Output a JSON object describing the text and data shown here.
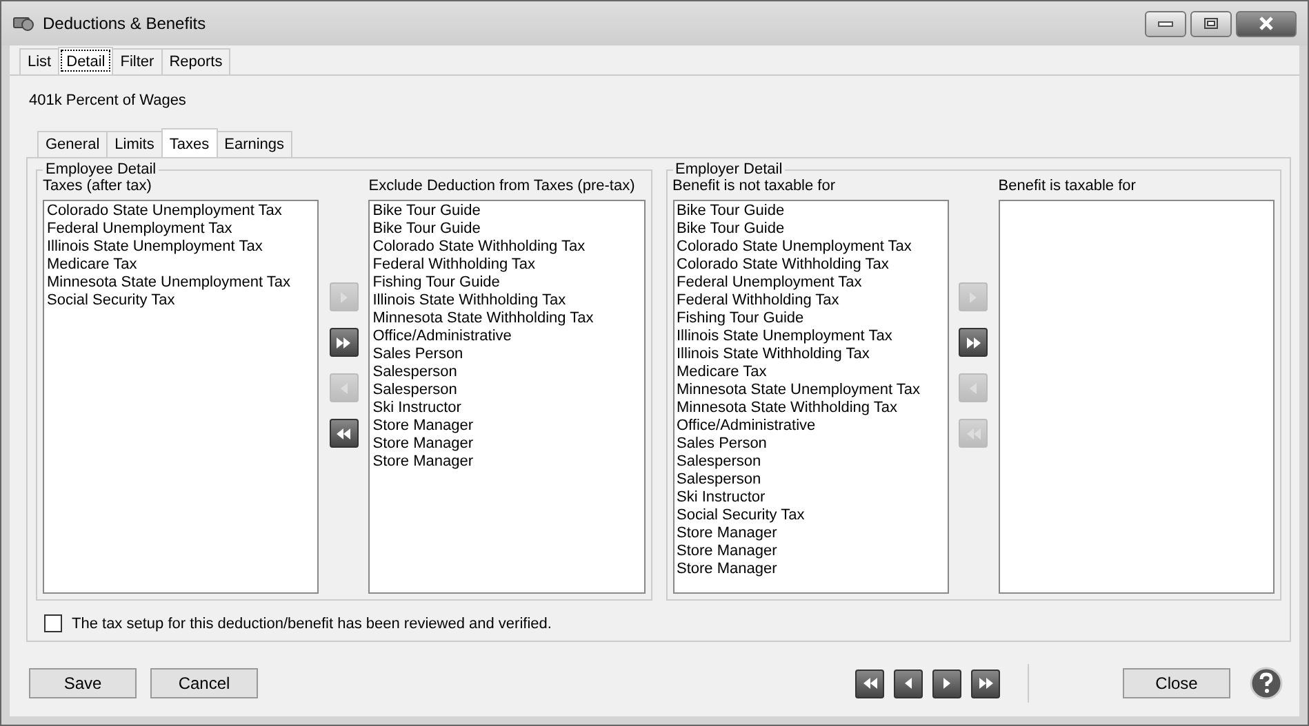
{
  "window": {
    "title": "Deductions & Benefits"
  },
  "tabs": [
    {
      "label": "List",
      "selected": false
    },
    {
      "label": "Detail",
      "selected": true
    },
    {
      "label": "Filter",
      "selected": false
    },
    {
      "label": "Reports",
      "selected": false
    }
  ],
  "record_title": "401k Percent of Wages",
  "sub_tabs": [
    {
      "label": "General",
      "selected": false
    },
    {
      "label": "Limits",
      "selected": false
    },
    {
      "label": "Taxes",
      "selected": true
    },
    {
      "label": "Earnings",
      "selected": false
    }
  ],
  "groups": [
    {
      "title": "Employee Detail",
      "left": {
        "label": "Taxes (after tax)",
        "items": [
          "Colorado State Unemployment Tax",
          "Federal Unemployment Tax",
          "Illinois State Unemployment Tax",
          "Medicare Tax",
          "Minnesota State Unemployment Tax",
          "Social Security Tax"
        ]
      },
      "transfer": [
        {
          "kind": "add",
          "disabled": true
        },
        {
          "kind": "add_all",
          "disabled": false
        },
        {
          "kind": "remove",
          "disabled": true
        },
        {
          "kind": "remove_all",
          "disabled": false
        }
      ],
      "right": {
        "label": "Exclude Deduction from Taxes (pre-tax)",
        "items": [
          "Bike Tour Guide",
          "Bike Tour Guide",
          "Colorado State Withholding Tax",
          "Federal Withholding Tax",
          "Fishing Tour Guide",
          "Illinois State Withholding Tax",
          "Minnesota State Withholding Tax",
          "Office/Administrative",
          "Sales Person",
          "Salesperson",
          "Salesperson",
          "Ski Instructor",
          "Store Manager",
          "Store Manager",
          "Store Manager"
        ]
      }
    },
    {
      "title": "Employer Detail",
      "left": {
        "label": "Benefit is not taxable for",
        "items": [
          "Bike Tour Guide",
          "Bike Tour Guide",
          "Colorado State Unemployment Tax",
          "Colorado State Withholding Tax",
          "Federal Unemployment Tax",
          "Federal Withholding Tax",
          "Fishing Tour Guide",
          "Illinois State Unemployment Tax",
          "Illinois State Withholding Tax",
          "Medicare Tax",
          "Minnesota State Unemployment Tax",
          "Minnesota State Withholding Tax",
          "Office/Administrative",
          "Sales Person",
          "Salesperson",
          "Salesperson",
          "Ski Instructor",
          "Social Security Tax",
          "Store Manager",
          "Store Manager",
          "Store Manager"
        ]
      },
      "transfer": [
        {
          "kind": "add",
          "disabled": true
        },
        {
          "kind": "add_all",
          "disabled": false
        },
        {
          "kind": "remove",
          "disabled": true
        },
        {
          "kind": "remove_all",
          "disabled": true
        }
      ],
      "right": {
        "label": "Benefit is taxable for"
      }
    }
  ],
  "verified": {
    "label": "The tax setup for this deduction/benefit has been reviewed and verified.",
    "checked": false
  },
  "buttons": [
    {
      "label": "Save"
    },
    {
      "label": "Cancel"
    }
  ],
  "nav": [
    {
      "kind": "remove_all",
      "disabled": false
    },
    {
      "kind": "remove",
      "disabled": false
    },
    {
      "kind": "add",
      "disabled": false
    },
    {
      "kind": "add_all",
      "disabled": false
    }
  ],
  "close_button": "Close"
}
